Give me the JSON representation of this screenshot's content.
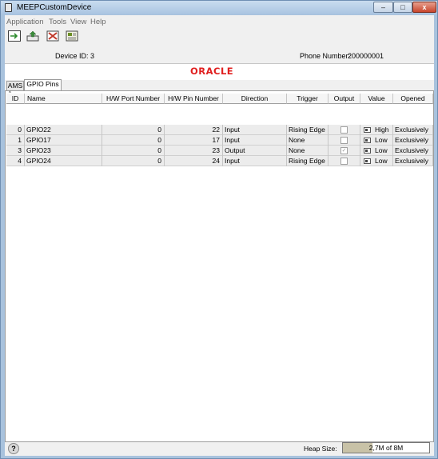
{
  "window": {
    "title": "MEEPCustomDevice",
    "minimize": "–",
    "maximize": "□",
    "close": "x"
  },
  "menu": [
    "Application",
    "Tools",
    "View",
    "Help"
  ],
  "toolbar": [
    {
      "icon": "run-icon",
      "color": "#2e8b2e"
    },
    {
      "icon": "install-icon",
      "color": "#3a8c3a"
    },
    {
      "icon": "stop-icon",
      "color": "#c0392b"
    },
    {
      "icon": "settings-icon",
      "color": "#6b8e23"
    }
  ],
  "device": {
    "id_label": "Device ID: 3",
    "phone_label": "Phone Number:",
    "phone_value": "200000001"
  },
  "logo": {
    "text": "ORACLE",
    "color": "#e01f1f"
  },
  "tabs": [
    "AMS",
    "GPIO Pins"
  ],
  "table": {
    "columns": [
      "ID",
      "Name",
      "H/W Port Number",
      "H/W Pin Number",
      "Direction",
      "Trigger",
      "Output",
      "Value",
      "Opened"
    ],
    "rows": [
      {
        "id": "0",
        "name": "GPIO22",
        "port": "0",
        "pin": "22",
        "direction": "Input",
        "trigger": "Rising Edge",
        "output": false,
        "value": "High",
        "opened": "Exclusively"
      },
      {
        "id": "1",
        "name": "GPIO17",
        "port": "0",
        "pin": "17",
        "direction": "Input",
        "trigger": "None",
        "output": false,
        "value": "Low",
        "opened": "Exclusively"
      },
      {
        "id": "3",
        "name": "GPIO23",
        "port": "0",
        "pin": "23",
        "direction": "Output",
        "trigger": "None",
        "output": true,
        "value": "Low",
        "opened": "Exclusively"
      },
      {
        "id": "4",
        "name": "GPIO24",
        "port": "0",
        "pin": "24",
        "direction": "Input",
        "trigger": "Rising Edge",
        "output": false,
        "value": "Low",
        "opened": "Exclusively"
      }
    ]
  },
  "status": {
    "help": "?",
    "heap_label": "Heap Size:",
    "heap_text": "2,7M of 8M",
    "heap_fraction": 0.34
  }
}
